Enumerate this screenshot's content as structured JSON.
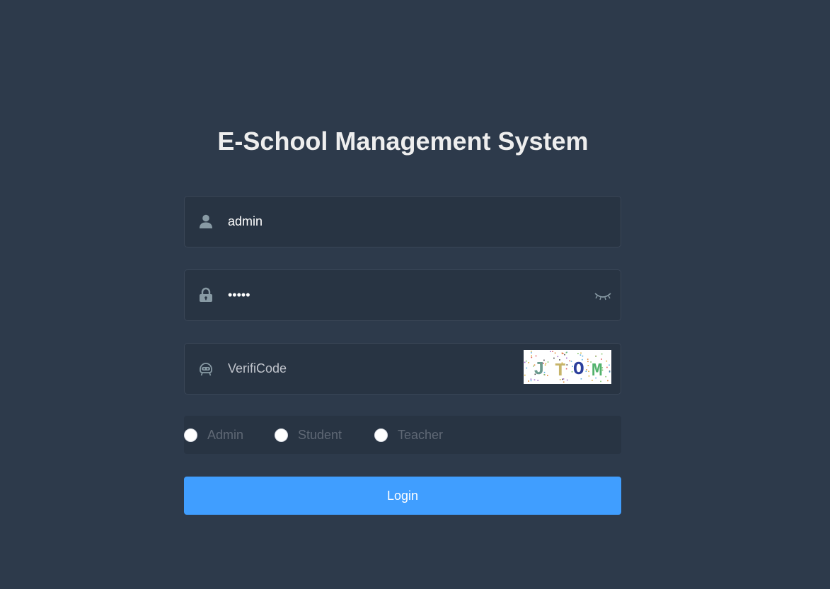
{
  "title": "E-School Management System",
  "username": {
    "value": "admin",
    "icon": "user-icon"
  },
  "password": {
    "value": "•••••",
    "icon": "lock-icon",
    "toggle_icon": "eye-closed-icon"
  },
  "verification": {
    "placeholder": "VerifiCode",
    "icon": "robot-icon",
    "captcha_text": "JTOM"
  },
  "roles": [
    {
      "label": "Admin",
      "selected": false
    },
    {
      "label": "Student",
      "selected": false
    },
    {
      "label": "Teacher",
      "selected": false
    }
  ],
  "login_label": "Login",
  "colors": {
    "background": "#2d3a4b",
    "input_background": "#283443",
    "primary": "#409eff",
    "icon": "#889aa4"
  }
}
